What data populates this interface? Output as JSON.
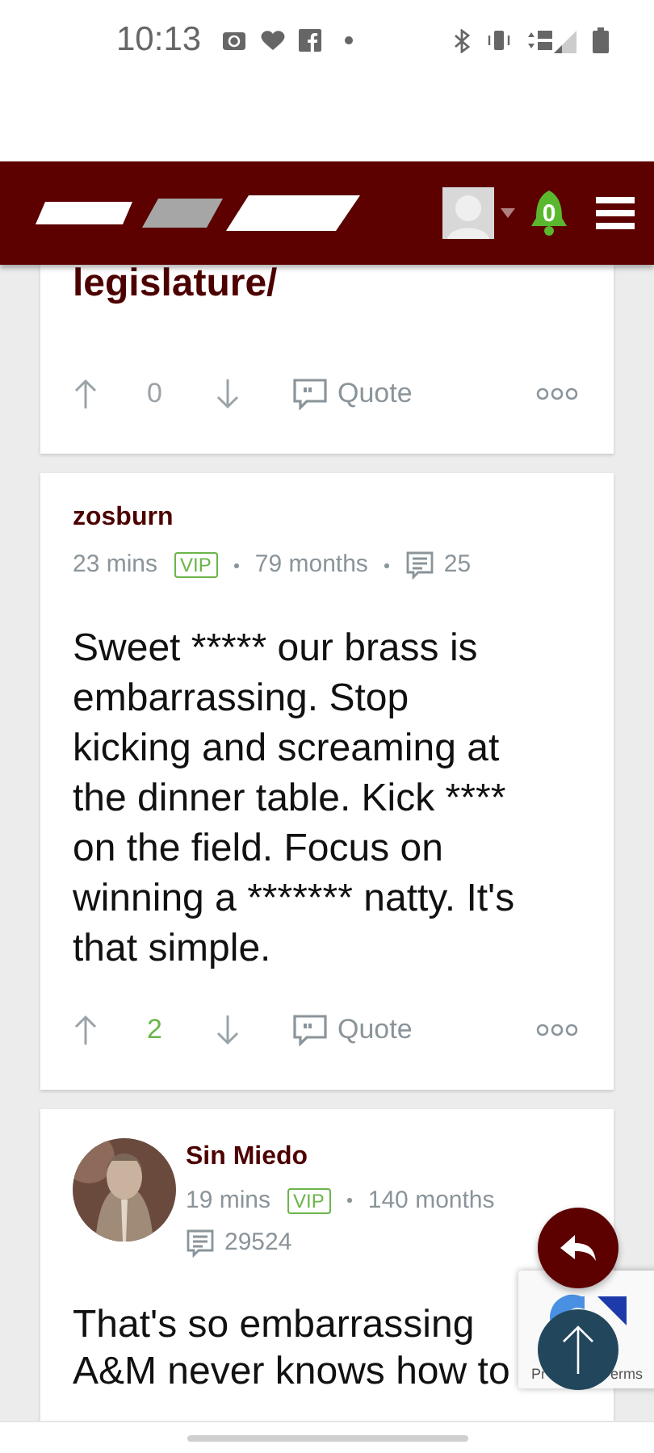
{
  "status_bar": {
    "time": "10:13"
  },
  "header": {
    "notification_count": "0"
  },
  "posts": [
    {
      "kind": "tail",
      "text": "legislature/",
      "votes": "0",
      "vote_positive": false,
      "quote": "Quote"
    },
    {
      "kind": "plain",
      "author": "zosburn",
      "time": "23 mins",
      "badge": "VIP",
      "tenure": "79 months",
      "post_count": "25",
      "body_lines": [
        "Sweet ***** our brass is",
        "embarrassing. Stop",
        "kicking and screaming at",
        "the dinner table. Kick ****",
        "on the field. Focus on",
        "winning a ******* natty. It's",
        "that simple."
      ],
      "votes": "2",
      "vote_positive": true,
      "quote": "Quote"
    },
    {
      "kind": "avatar",
      "author": "Sin Miedo",
      "time": "19 mins",
      "badge": "VIP",
      "tenure": "140 months",
      "post_count": "29524",
      "body_lines": [
        "That's so embarrassing",
        "A&M never knows how to"
      ]
    }
  ],
  "recaptcha": {
    "text_left": "Pr",
    "text_right": "erms"
  }
}
